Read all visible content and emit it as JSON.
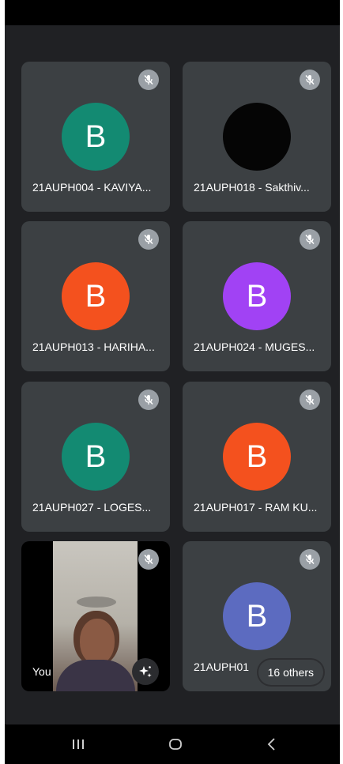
{
  "participants": [
    {
      "name": "21AUPH004 - KAVIYA...",
      "initial": "B",
      "avatar_color": "#138a72",
      "muted": true
    },
    {
      "name": "21AUPH018 - Sakthiv...",
      "initial": "",
      "avatar_color": "#050505",
      "muted": true
    },
    {
      "name": "21AUPH013 - HARIHA...",
      "initial": "B",
      "avatar_color": "#f4511e",
      "muted": true
    },
    {
      "name": "21AUPH024 - MUGES...",
      "initial": "B",
      "avatar_color": "#a142f4",
      "muted": true
    },
    {
      "name": "21AUPH027 - LOGES...",
      "initial": "B",
      "avatar_color": "#138a72",
      "muted": true
    },
    {
      "name": "21AUPH017 - RAM KU...",
      "initial": "B",
      "avatar_color": "#f4511e",
      "muted": true
    }
  ],
  "self_tile": {
    "label": "You",
    "muted": true
  },
  "others_tile": {
    "name": "21AUPH01",
    "initial": "B",
    "avatar_color": "#5c6bc0",
    "muted": true,
    "others_label": "16 others"
  },
  "nav": {
    "recents": "recent-apps",
    "home": "home",
    "back": "back"
  }
}
